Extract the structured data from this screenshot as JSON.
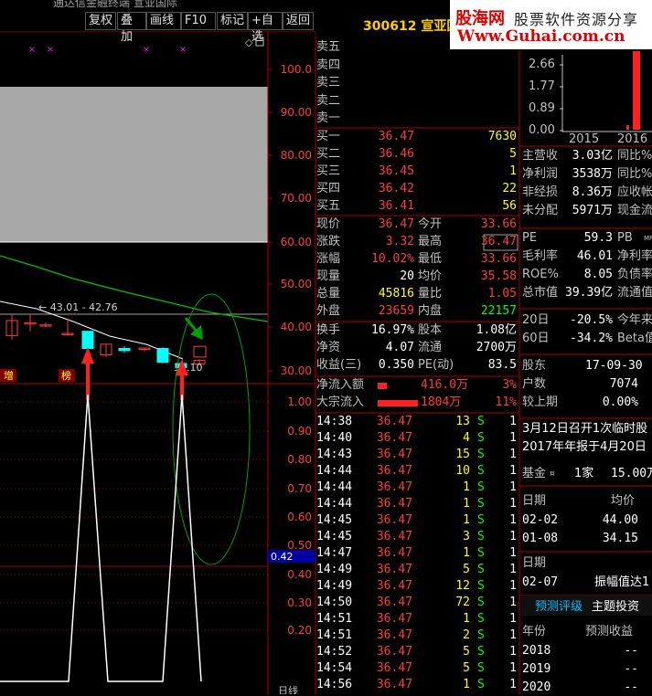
{
  "window": {
    "title": "通达信金融终端 宣亚国际"
  },
  "toolbar": {
    "buttons": [
      "复权",
      "叠加",
      "画线",
      "F10",
      "标记",
      "+自选",
      "返回"
    ]
  },
  "stock": {
    "code_name": "300612 宣亚国"
  },
  "watermark": {
    "line1": "股海网",
    "line1b": "股票软件资源分享",
    "line2": "Www.Guhai.com.cn"
  },
  "kline": {
    "price_axis": [
      "100.0",
      "90.00",
      "80.00",
      "70.00",
      "60.00",
      "50.00",
      "40.00",
      "30.00"
    ],
    "range_label": "43.01 - 42.76",
    "low_label": "31.10",
    "tag1": "增",
    "tag2": "榜",
    "candles": [
      {
        "o": 38,
        "c": 41.5,
        "h": 43,
        "l": 37
      },
      {
        "o": 41,
        "c": 41,
        "h": 43.01,
        "l": 39
      },
      {
        "o": 40.5,
        "c": 40.5,
        "h": 41,
        "l": 40
      },
      {
        "o": 38.5,
        "c": 38.5,
        "h": 42,
        "l": 38
      },
      {
        "o": 39,
        "c": 35,
        "h": 39,
        "l": 34.5
      },
      {
        "o": 33.5,
        "c": 36,
        "h": 36,
        "l": 33
      },
      {
        "o": 35,
        "c": 34.5,
        "h": 35.5,
        "l": 34
      },
      {
        "o": 34.8,
        "c": 35.1,
        "h": 35.2,
        "l": 34.3
      },
      {
        "o": 35,
        "c": 31.8,
        "h": 35.2,
        "l": 31.5
      },
      {
        "o": 31.5,
        "c": 30.5,
        "h": 32,
        "l": 30
      },
      {
        "o": 31.4,
        "c": 32.2,
        "h": 32.5,
        "l": 31.1
      },
      {
        "o": 33,
        "c": 35.5,
        "h": 36,
        "l": 33
      }
    ]
  },
  "indicator": {
    "axis": [
      "1.00",
      "0.90",
      "0.80",
      "0.70",
      "0.60",
      "0.50",
      "0.40",
      "0.30",
      "0.20"
    ],
    "current": "0.42",
    "bottom_label": "日线"
  },
  "order_book": {
    "sell": [
      {
        "label": "卖五"
      },
      {
        "label": "卖四"
      },
      {
        "label": "卖三"
      },
      {
        "label": "卖二"
      },
      {
        "label": "卖一"
      }
    ],
    "buy": [
      {
        "label": "买一",
        "price": "36.47",
        "vol": "7630"
      },
      {
        "label": "买二",
        "price": "36.46",
        "vol": "5"
      },
      {
        "label": "买三",
        "price": "36.45",
        "vol": "1"
      },
      {
        "label": "买四",
        "price": "36.42",
        "vol": "22"
      },
      {
        "label": "买五",
        "price": "36.41",
        "vol": "56"
      }
    ]
  },
  "quote": [
    {
      "l1": "现价",
      "v1": "36.47",
      "c1": "red",
      "l2": "今开",
      "v2": "33.66",
      "c2": "red"
    },
    {
      "l1": "涨跌",
      "v1": "3.32",
      "c1": "red",
      "l2": "最高",
      "v2": "36.47",
      "c2": "red"
    },
    {
      "l1": "涨幅",
      "v1": "10.02%",
      "c1": "red",
      "l2": "最低",
      "v2": "33.66",
      "c2": "red"
    },
    {
      "l1": "现量",
      "v1": "20",
      "c1": "wht",
      "l2": "均价",
      "v2": "35.58",
      "c2": "red"
    },
    {
      "l1": "总量",
      "v1": "45816",
      "c1": "yel",
      "l2": "量比",
      "v2": "1.05",
      "c2": "red"
    },
    {
      "l1": "外盘",
      "v1": "23659",
      "c1": "red",
      "l2": "内盘",
      "v2": "22157",
      "c2": "grn"
    }
  ],
  "fund": [
    {
      "l1": "换手",
      "v1": "16.97%",
      "l2": "股本",
      "v2": "1.08亿"
    },
    {
      "l1": "净资",
      "v1": "4.07",
      "l2": "流通",
      "v2": "2700万"
    },
    {
      "l1": "收益(三)",
      "v1": "0.350",
      "l2": "PE(动)",
      "v2": "83.5"
    }
  ],
  "flow": [
    {
      "label": "净流入额",
      "value": "416.0万",
      "pct": "3%"
    },
    {
      "label": "大宗流入",
      "value": "1804万",
      "pct": "11%"
    }
  ],
  "ticks": [
    {
      "t": "14:38",
      "p": "36.47",
      "v": "13",
      "s": "S",
      "n": "1"
    },
    {
      "t": "14:40",
      "p": "36.47",
      "v": "4",
      "s": "S",
      "n": "1"
    },
    {
      "t": "14:43",
      "p": "36.47",
      "v": "15",
      "s": "S",
      "n": "1"
    },
    {
      "t": "14:44",
      "p": "36.47",
      "v": "10",
      "s": "S",
      "n": "1"
    },
    {
      "t": "14:44",
      "p": "36.47",
      "v": "1",
      "s": "S",
      "n": "1"
    },
    {
      "t": "14:44",
      "p": "36.47",
      "v": "1",
      "s": "S",
      "n": "1"
    },
    {
      "t": "14:45",
      "p": "36.47",
      "v": "1",
      "s": "S",
      "n": "1"
    },
    {
      "t": "14:45",
      "p": "36.47",
      "v": "3",
      "s": "S",
      "n": "1"
    },
    {
      "t": "14:47",
      "p": "36.47",
      "v": "1",
      "s": "S",
      "n": "1"
    },
    {
      "t": "14:49",
      "p": "36.47",
      "v": "5",
      "s": "S",
      "n": "1"
    },
    {
      "t": "14:49",
      "p": "36.47",
      "v": "12",
      "s": "S",
      "n": "1"
    },
    {
      "t": "14:50",
      "p": "36.47",
      "v": "72",
      "s": "S",
      "n": "1"
    },
    {
      "t": "14:51",
      "p": "36.47",
      "v": "1",
      "s": "S",
      "n": "1"
    },
    {
      "t": "14:51",
      "p": "36.47",
      "v": "2",
      "s": "S",
      "n": "1"
    },
    {
      "t": "14:52",
      "p": "36.47",
      "v": "5",
      "s": "S",
      "n": "1"
    },
    {
      "t": "14:54",
      "p": "36.47",
      "v": "5",
      "s": "S",
      "n": "1"
    },
    {
      "t": "14:56",
      "p": "36.47",
      "v": "1",
      "s": "S",
      "n": "1"
    }
  ],
  "f10": {
    "bar_axis": [
      "2.66",
      "1.77",
      "0.89",
      "0.00"
    ],
    "bar_years": [
      "2015",
      "2016"
    ],
    "rows1": [
      {
        "l": "主营收",
        "v": "3.03亿",
        "r": "同比%"
      },
      {
        "l": "净利润",
        "v": "3538万",
        "r": "同比%"
      },
      {
        "l": "非经损",
        "v": "8.36万",
        "r": "应收帐"
      },
      {
        "l": "未分配",
        "v": "5971万",
        "r": "现金流"
      }
    ],
    "rows2": [
      {
        "l": "PE",
        "v": "59.3",
        "r": "PB"
      },
      {
        "l": "毛利率",
        "v": "46.01",
        "r": "净利率"
      },
      {
        "l": "ROE%",
        "v": "8.05",
        "r": "负债率"
      },
      {
        "l": "总市值",
        "v": "39.39亿",
        "r": "流通值"
      }
    ],
    "rows3": [
      {
        "l": "20日",
        "v": "-20.5%",
        "r": "今年来"
      },
      {
        "l": "60日",
        "v": "-34.2%",
        "r": "Beta值"
      }
    ],
    "holders": [
      {
        "l": "股东",
        "v": "17-09-30"
      },
      {
        "l": "户数",
        "v": "7074"
      },
      {
        "l": "较上期",
        "v": "0.00%"
      }
    ],
    "news": [
      "3月12日召开1次临时股",
      "2017年年报于4月20日"
    ],
    "fundrow": {
      "l": "基金",
      "v": "1家",
      "r": "15.00万"
    },
    "dates": {
      "h1": "日期",
      "h2": "均价",
      "rows": [
        {
          "d": "02-02",
          "p": "44.00"
        },
        {
          "d": "01-08",
          "p": "34.15"
        }
      ]
    },
    "dates2": {
      "h": "日期",
      "row_d": "02-07",
      "row_t": "振幅值达1"
    },
    "tabs": [
      "预测评级",
      "主题投资"
    ],
    "forecast": {
      "h1": "年份",
      "h2": "预测收益",
      "rows": [
        {
          "y": "2018",
          "v": "--"
        },
        {
          "y": "2019",
          "v": "--"
        },
        {
          "y": "2020",
          "v": "--"
        }
      ]
    }
  },
  "colors": {
    "up": "#ff3c3c",
    "down": "#00ffff",
    "grid": "#a00000",
    "ma": "#00c000"
  }
}
